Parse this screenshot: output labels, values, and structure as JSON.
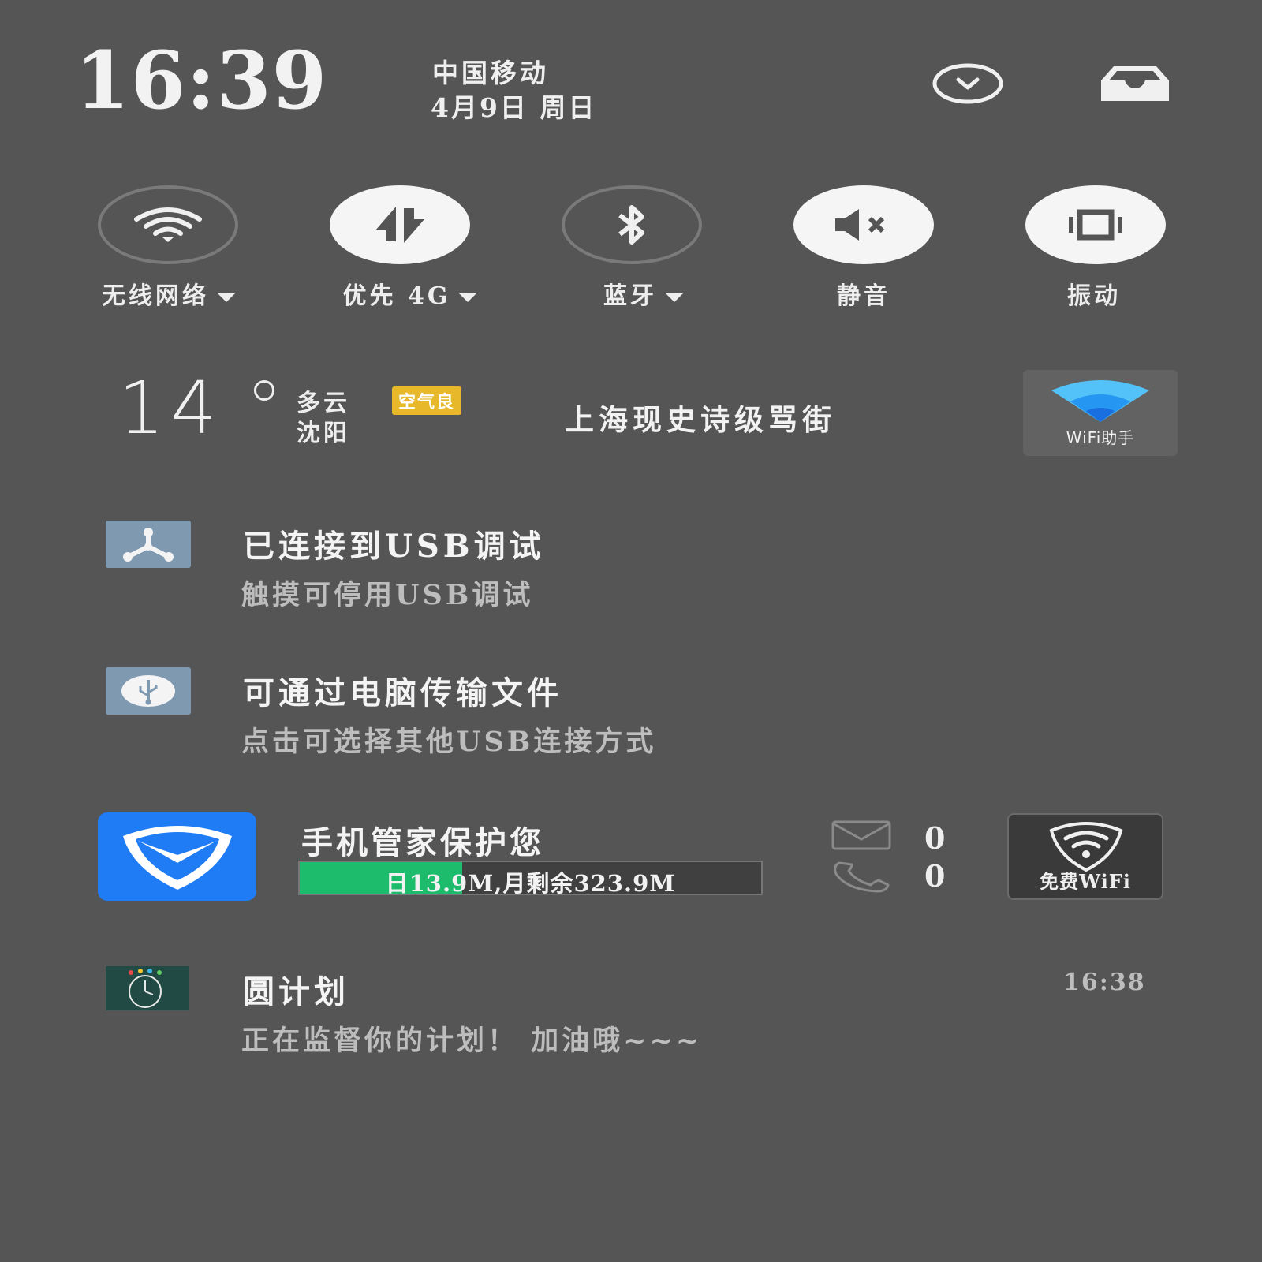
{
  "header": {
    "time": "16:39",
    "carrier": "中国移动",
    "date": "4月9日 周日",
    "collapse_icon": "chevron-down-circle-icon",
    "inbox_icon": "tray-icon"
  },
  "quick_settings": [
    {
      "label": "无线网络",
      "icon": "wifi-icon",
      "state": "off",
      "has_dropdown": true
    },
    {
      "label": "优先 4G",
      "icon": "mobile-data-icon",
      "state": "on",
      "has_dropdown": true
    },
    {
      "label": "蓝牙",
      "icon": "bluetooth-icon",
      "state": "off",
      "has_dropdown": true
    },
    {
      "label": "静音",
      "icon": "mute-icon",
      "state": "on",
      "has_dropdown": false
    },
    {
      "label": "振动",
      "icon": "vibrate-icon",
      "state": "on",
      "has_dropdown": false
    }
  ],
  "weather": {
    "temperature": "14",
    "condition": "多云",
    "city": "沈阳",
    "air_quality": "空气良",
    "headline": "上海现史诗级骂街"
  },
  "wifi_helper": {
    "label": "WiFi助手"
  },
  "notifications": {
    "usb_debug": {
      "title": "已连接到USB调试",
      "subtitle": "触摸可停用USB调试",
      "icon": "usb-debug-icon"
    },
    "usb_transfer": {
      "title": "可通过电脑传输文件",
      "subtitle": "点击可选择其他USB连接方式",
      "icon": "usb-icon"
    },
    "phone_manager": {
      "title": "手机管家保护您",
      "usage_text": "日13.9M,月剩余323.9M",
      "messages": "0",
      "calls": "0",
      "free_wifi": "免费WiFi"
    },
    "plan": {
      "title": "圆计划",
      "subtitle": "正在监督你的计划！ 加油哦~~~",
      "time": "16:38"
    }
  },
  "colors": {
    "background": "#555555",
    "accent_green": "#1cbc6c",
    "air_quality_badge": "#e7b829",
    "phone_manager_blue": "#1f7cf5",
    "wifi_blue": "#2aa4f4"
  }
}
